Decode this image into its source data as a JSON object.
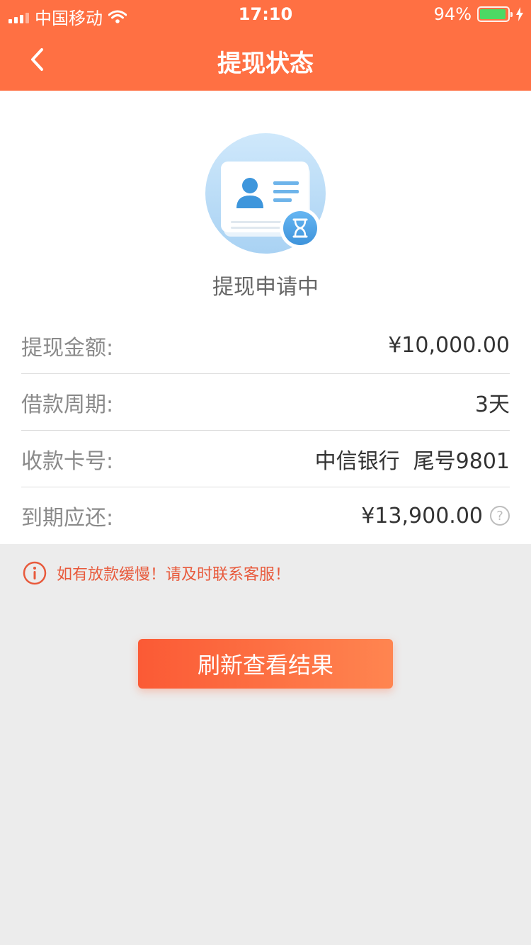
{
  "status_bar": {
    "carrier": "中国移动",
    "time": "17:10",
    "battery_percent": "94%",
    "battery_level": 0.94
  },
  "nav": {
    "title": "提现状态",
    "back_icon": "chevron-left-icon"
  },
  "status": {
    "text": "提现申请中",
    "icon": "id-card-hourglass-icon"
  },
  "details": [
    {
      "label": "提现金额:",
      "value": "¥10,000.00"
    },
    {
      "label": "借款周期:",
      "value": "3天"
    },
    {
      "label": "收款卡号:",
      "value": "中信银行  尾号9801"
    },
    {
      "label": "到期应还:",
      "value": "¥13,900.00",
      "help_icon": "?"
    }
  ],
  "notice": {
    "icon": "info-icon",
    "text": "如有放款缓慢！请及时联系客服！"
  },
  "refresh_button": {
    "label": "刷新查看结果"
  },
  "colors": {
    "primary": "#ff7043",
    "notice": "#e85a3c",
    "battery": "#4cd964"
  }
}
